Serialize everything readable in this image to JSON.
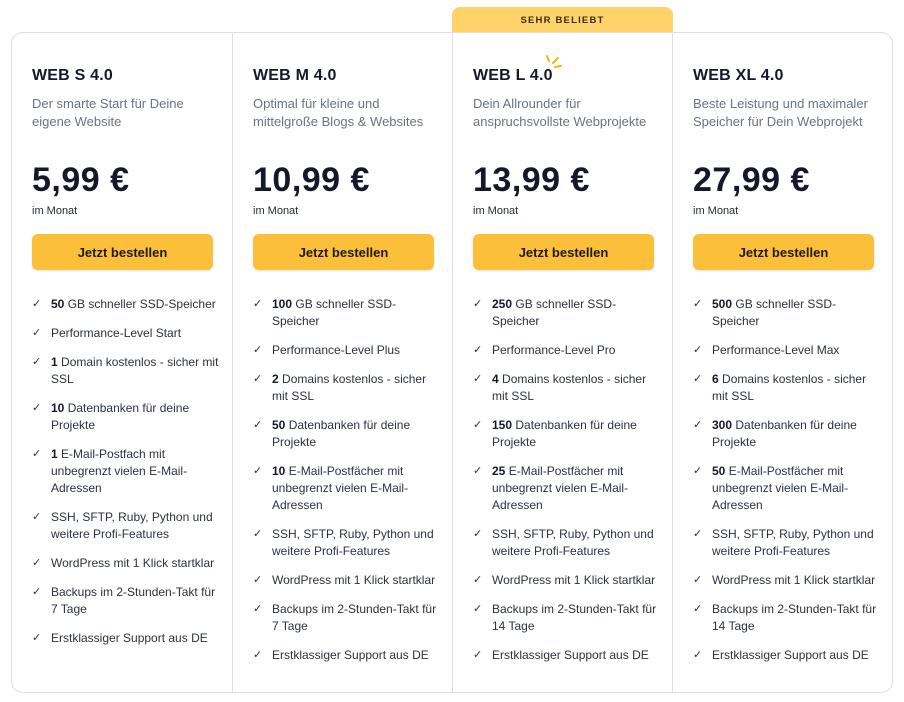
{
  "badge": "SEHR BELIEBT",
  "plans": [
    {
      "name": "WEB S 4.0",
      "desc": "Der smarte Start für Deine eigene Website",
      "price": "5,99 €",
      "period": "im Monat",
      "button": "Jetzt bestellen",
      "features": [
        {
          "bold": "50",
          "text": " GB schneller SSD-Speicher"
        },
        {
          "bold": "",
          "text": "Performance-Level Start"
        },
        {
          "bold": "1",
          "text": " Domain kostenlos - sicher mit SSL"
        },
        {
          "bold": "10",
          "text": " Datenbanken für deine Projekte"
        },
        {
          "bold": "1",
          "text": " E-Mail-Postfach mit unbegrenzt vielen E-Mail-Adressen"
        },
        {
          "bold": "",
          "text": "SSH, SFTP, Ruby, Python und weitere Profi-Features"
        },
        {
          "bold": "",
          "text": "WordPress mit 1 Klick startklar"
        },
        {
          "bold": "",
          "text": "Backups im 2-Stunden-Takt für 7 Tage"
        },
        {
          "bold": "",
          "text": "Erstklassiger Support aus DE"
        }
      ]
    },
    {
      "name": "WEB M 4.0",
      "desc": "Optimal für kleine und mittelgroße Blogs & Websites",
      "price": "10,99 €",
      "period": "im Monat",
      "button": "Jetzt bestellen",
      "features": [
        {
          "bold": "100",
          "text": " GB schneller SSD-Speicher"
        },
        {
          "bold": "",
          "text": "Performance-Level Plus"
        },
        {
          "bold": "2",
          "text": " Domains kostenlos - sicher mit SSL"
        },
        {
          "bold": "50",
          "text": " Datenbanken für deine Projekte"
        },
        {
          "bold": "10",
          "text": " E-Mail-Postfächer mit unbegrenzt vielen E-Mail-Adressen"
        },
        {
          "bold": "",
          "text": "SSH, SFTP, Ruby, Python und weitere Profi-Features"
        },
        {
          "bold": "",
          "text": "WordPress mit 1 Klick startklar"
        },
        {
          "bold": "",
          "text": "Backups im 2-Stunden-Takt für 7 Tage"
        },
        {
          "bold": "",
          "text": "Erstklassiger Support aus DE"
        }
      ]
    },
    {
      "name": "WEB L 4.0",
      "desc": "Dein Allrounder für anspruchsvollste Webprojekte",
      "price": "13,99 €",
      "period": "im Monat",
      "button": "Jetzt bestellen",
      "features": [
        {
          "bold": "250",
          "text": " GB schneller SSD-Speicher"
        },
        {
          "bold": "",
          "text": "Performance-Level Pro"
        },
        {
          "bold": "4",
          "text": " Domains kostenlos - sicher mit SSL"
        },
        {
          "bold": "150",
          "text": " Datenbanken für deine Projekte"
        },
        {
          "bold": "25",
          "text": " E-Mail-Postfächer mit unbegrenzt vielen E-Mail-Adressen"
        },
        {
          "bold": "",
          "text": "SSH, SFTP, Ruby, Python und weitere Profi-Features"
        },
        {
          "bold": "",
          "text": "WordPress mit 1 Klick startklar"
        },
        {
          "bold": "",
          "text": "Backups im 2-Stunden-Takt für 14 Tage"
        },
        {
          "bold": "",
          "text": "Erstklassiger Support aus DE"
        }
      ]
    },
    {
      "name": "WEB XL 4.0",
      "desc": "Beste Leistung und maximaler Speicher für Dein Webprojekt",
      "price": "27,99 €",
      "period": "im Monat",
      "button": "Jetzt bestellen",
      "features": [
        {
          "bold": "500",
          "text": " GB schneller SSD-Speicher"
        },
        {
          "bold": "",
          "text": "Performance-Level Max"
        },
        {
          "bold": "6",
          "text": " Domains kostenlos - sicher mit SSL"
        },
        {
          "bold": "300",
          "text": " Datenbanken für deine Projekte"
        },
        {
          "bold": "50",
          "text": " E-Mail-Postfächer mit unbegrenzt vielen E-Mail-Adressen"
        },
        {
          "bold": "",
          "text": "SSH, SFTP, Ruby, Python und weitere Profi-Features"
        },
        {
          "bold": "",
          "text": "WordPress mit 1 Klick startklar"
        },
        {
          "bold": "",
          "text": "Backups im 2-Stunden-Takt für 14 Tage"
        },
        {
          "bold": "",
          "text": "Erstklassiger Support aus DE"
        }
      ]
    }
  ],
  "colors": {
    "accent": "#fcbf3a",
    "badge_bg": "#ffd26a",
    "text_dark": "#15182a",
    "text_muted": "#6b7280",
    "border": "#dcdfe4"
  },
  "icons": {
    "check": "check-icon",
    "sparkle": "sparkle-icon"
  }
}
